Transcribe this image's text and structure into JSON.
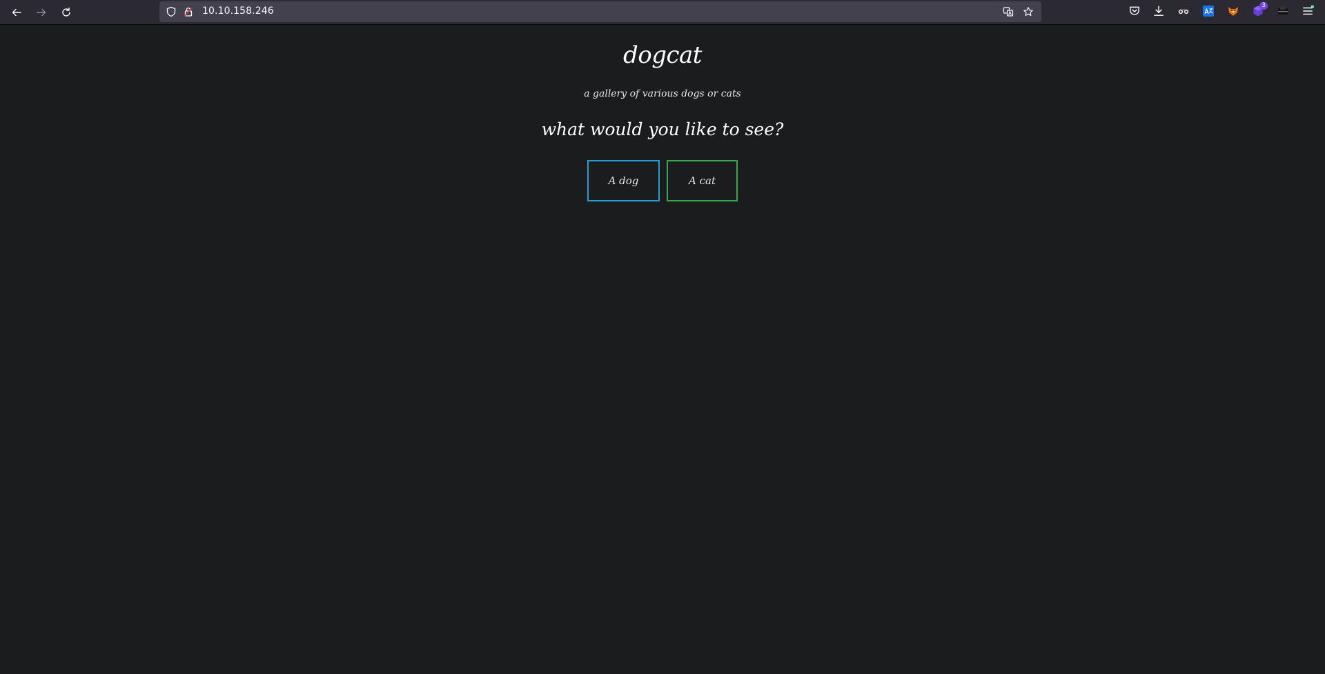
{
  "browser": {
    "url": "10.10.158.246",
    "extension_badge": "3"
  },
  "page": {
    "title": "dogcat",
    "subtitle": "a gallery of various dogs or cats",
    "question": "what would you like to see?",
    "buttons": {
      "dog": "A dog",
      "cat": "A cat"
    },
    "colors": {
      "dog_border": "#1e9fd6",
      "cat_border": "#3aa84a",
      "background": "#1b1c1e"
    }
  }
}
